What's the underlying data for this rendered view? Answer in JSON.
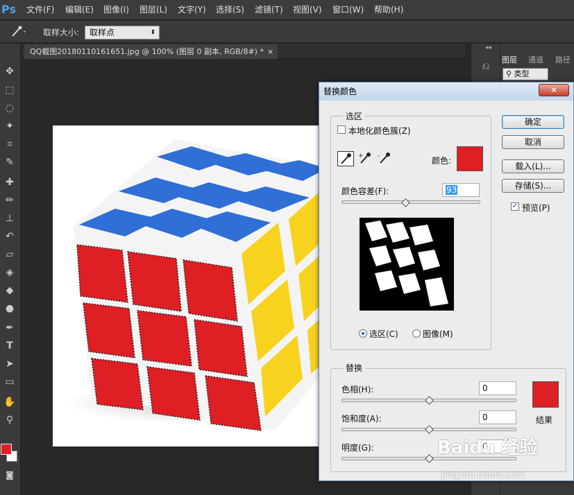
{
  "app": {
    "logo": "Ps"
  },
  "menubar": {
    "items": [
      "文件(F)",
      "编辑(E)",
      "图像(I)",
      "图层(L)",
      "文字(Y)",
      "选择(S)",
      "滤镜(T)",
      "视图(V)",
      "窗口(W)",
      "帮助(H)"
    ]
  },
  "options": {
    "sample_size_label": "取样大小:",
    "sample_size_value": "取样点"
  },
  "document": {
    "tab_title": "QQ截图20180110161651.jpg @ 100% (图层 0 副本, RGB/8#) *",
    "tab_close": "×"
  },
  "panels": {
    "tabs": [
      "图层",
      "通道",
      "路径"
    ],
    "filter_kind": "类型",
    "collapse": "◂◂"
  },
  "dialog": {
    "title": "替换颜色",
    "close": "✕",
    "selection_group": "选区",
    "localized_clusters": "本地化颜色簇(Z)",
    "localized_clusters_checked": false,
    "color_label": "颜色:",
    "color_value": "#de1f24",
    "fuzziness_label": "颜色容差(F):",
    "fuzziness_value": "93",
    "fuzziness_fraction": 0.46,
    "preview_mode": {
      "selection": "选区(C)",
      "image": "图像(M)",
      "selected": "selection"
    },
    "buttons": {
      "ok": "确定",
      "cancel": "取消",
      "load": "载入(L)...",
      "save": "存储(S)..."
    },
    "preview": {
      "label": "预览(P)",
      "checked": true
    },
    "replacement_group": "替换",
    "hue": {
      "label": "色相(H):",
      "value": "0",
      "fraction": 0.5
    },
    "saturation": {
      "label": "饱和度(A):",
      "value": "0",
      "fraction": 0.5
    },
    "lightness": {
      "label": "明度(G):",
      "value": "0",
      "fraction": 0.5
    },
    "result_label": "结果",
    "result_color": "#de1f24"
  },
  "watermark": {
    "text": "Baidu 经验",
    "url": "jingyan.baidu.com"
  }
}
